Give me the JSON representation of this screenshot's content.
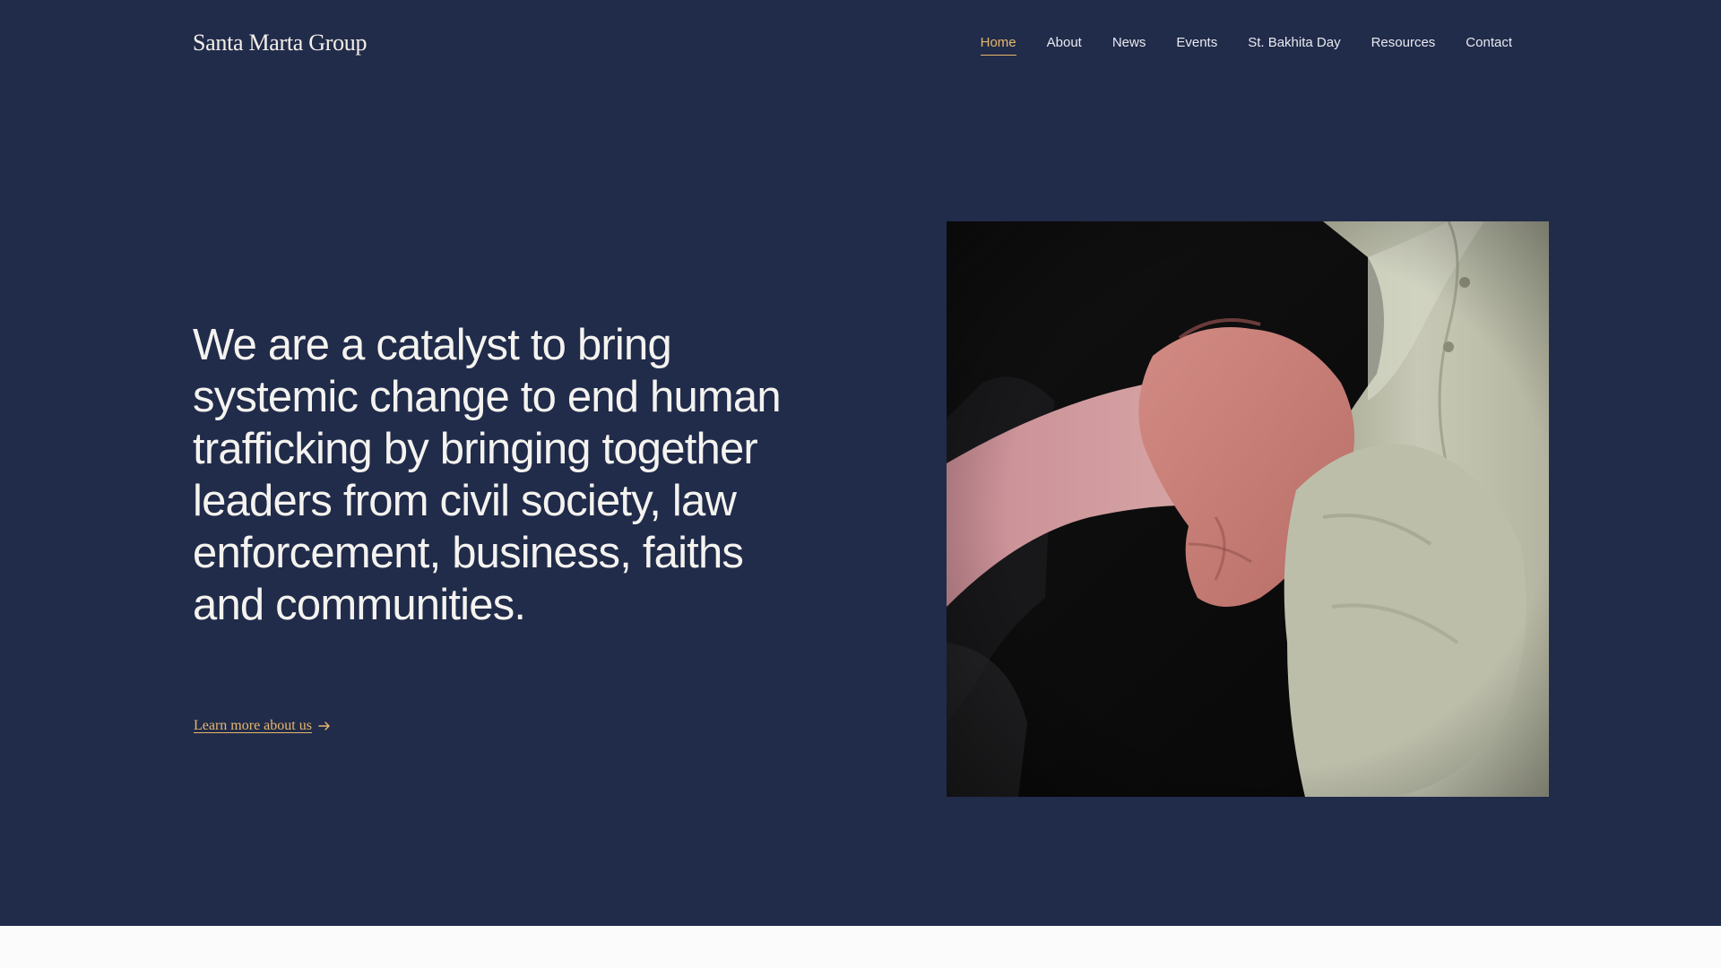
{
  "header": {
    "logo": "Santa Marta Group",
    "nav": [
      {
        "label": "Home",
        "active": true
      },
      {
        "label": "About",
        "active": false
      },
      {
        "label": "News",
        "active": false
      },
      {
        "label": "Events",
        "active": false
      },
      {
        "label": "St. Bakhita Day",
        "active": false
      },
      {
        "label": "Resources",
        "active": false
      },
      {
        "label": "Contact",
        "active": false
      }
    ]
  },
  "hero": {
    "headline": "We are a catalyst to bring systemic change to end human trafficking by bringing together leaders from civil society, law enforcement, business, faiths and communities.",
    "link_label": "Learn more about us",
    "link_icon": "arrow-right-icon",
    "image_subject": "clasped-hands-photo"
  },
  "colors": {
    "background": "#212b4a",
    "accent": "#e8b86c",
    "text": "#f4f3ef",
    "lower_section": "#fbfbfb"
  }
}
